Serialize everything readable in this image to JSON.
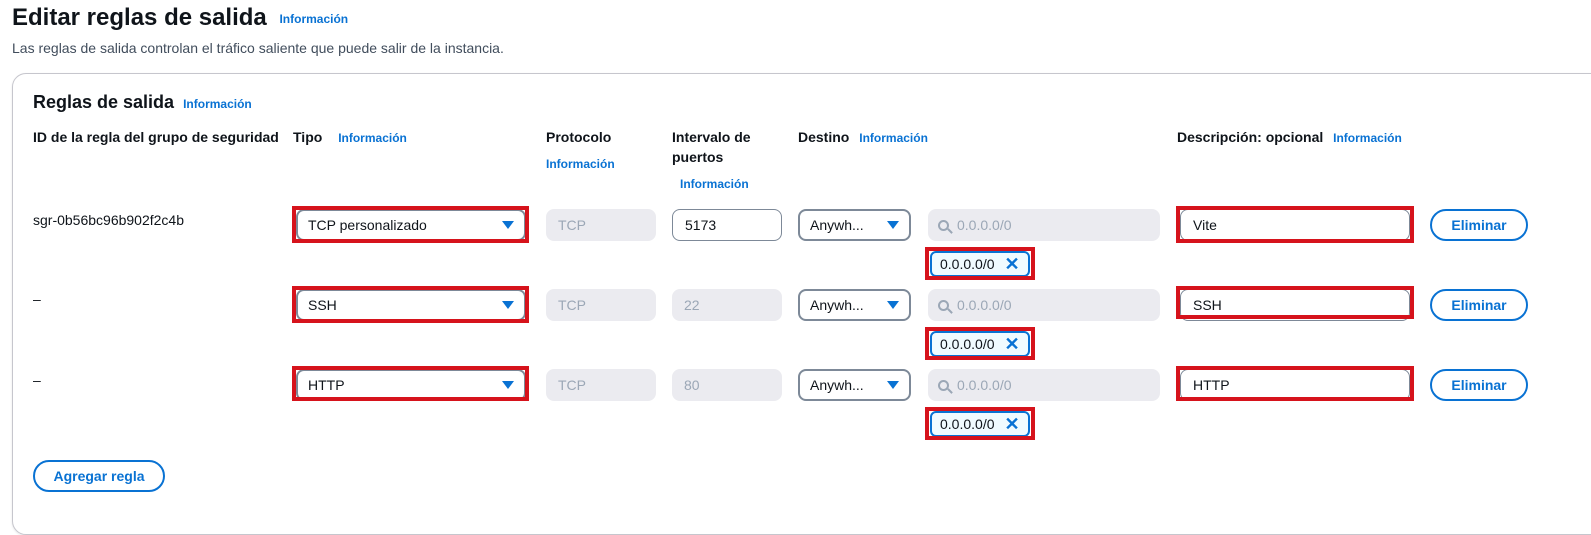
{
  "page": {
    "title": "Editar reglas de salida",
    "title_info": "Información",
    "subtitle": "Las reglas de salida controlan el tráfico saliente que puede salir de la instancia."
  },
  "panel": {
    "title": "Reglas de salida",
    "title_info": "Información",
    "headers": {
      "rule_id": "ID de la regla del grupo de seguridad",
      "type": "Tipo",
      "type_info": "Información",
      "protocol": "Protocolo",
      "protocol_info": "Información",
      "port_range_line1": "Intervalo de",
      "port_range_line2": "puertos",
      "port_range_info": "Información",
      "destination": "Destino",
      "destination_info": "Información",
      "description": "Descripción: opcional",
      "description_info": "Información"
    },
    "rows": [
      {
        "rule_id": "sgr-0b56bc96b902f2c4b",
        "type": "TCP personalizado",
        "protocol": "TCP",
        "port": "5173",
        "destination": "Anywh...",
        "search_placeholder": "0.0.0.0/0",
        "token": "0.0.0.0/0",
        "description": "Vite",
        "delete": "Eliminar"
      },
      {
        "rule_id": "–",
        "type": "SSH",
        "protocol": "TCP",
        "port": "22",
        "destination": "Anywh...",
        "search_placeholder": "0.0.0.0/0",
        "token": "0.0.0.0/0",
        "description": "SSH",
        "delete": "Eliminar"
      },
      {
        "rule_id": "–",
        "type": "HTTP",
        "protocol": "TCP",
        "port": "80",
        "destination": "Anywh...",
        "search_placeholder": "0.0.0.0/0",
        "token": "0.0.0.0/0",
        "description": "HTTP",
        "delete": "Eliminar"
      }
    ],
    "add_rule": "Agregar regla"
  },
  "colors": {
    "accent": "#0972d3",
    "highlight": "#d6131c",
    "disabled_bg": "#ebebf0"
  }
}
